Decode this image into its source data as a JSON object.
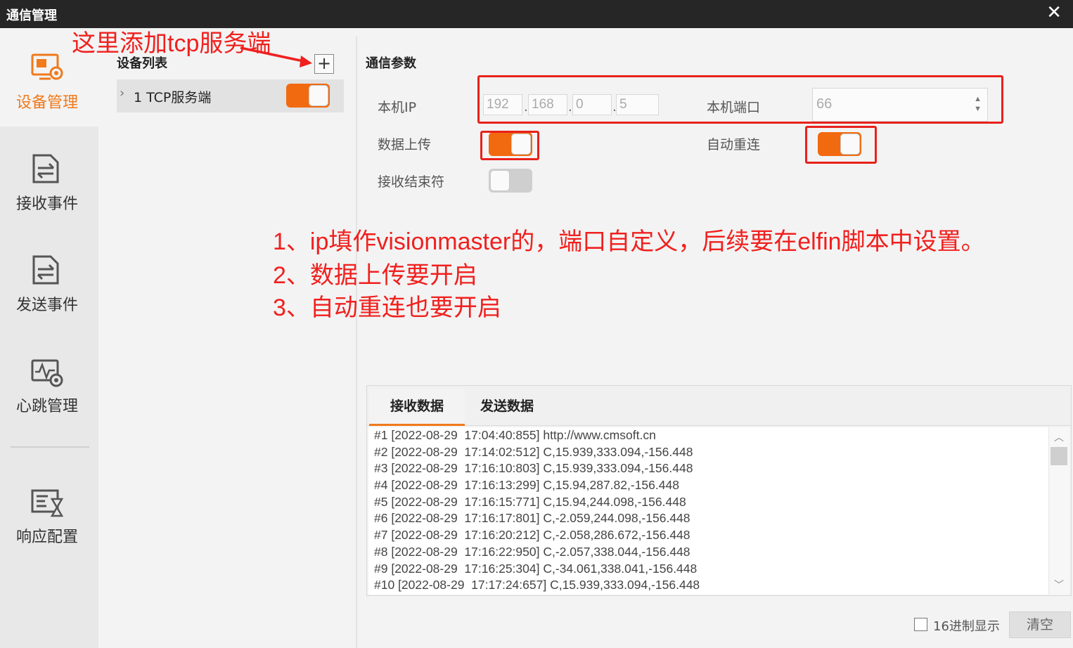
{
  "window": {
    "title": "通信管理",
    "close_glyph": "✕"
  },
  "sidebar": {
    "items": [
      {
        "label": "设备管理",
        "icon": "device-manage-icon",
        "active": true
      },
      {
        "label": "接收事件",
        "icon": "receive-event-icon",
        "active": false
      },
      {
        "label": "发送事件",
        "icon": "send-event-icon",
        "active": false
      },
      {
        "label": "心跳管理",
        "icon": "heartbeat-icon",
        "active": false
      },
      {
        "label": "响应配置",
        "icon": "response-config-icon",
        "active": false
      }
    ]
  },
  "device_list": {
    "header": "设备列表",
    "add_glyph": "+",
    "rows": [
      {
        "chevron": "›",
        "label": "1 TCP服务端",
        "enabled": true
      }
    ]
  },
  "params": {
    "header": "通信参数",
    "local_ip_label": "本机IP",
    "ip": [
      "192",
      "168",
      "0",
      "5"
    ],
    "local_port_label": "本机端口",
    "port": "66",
    "upload_label": "数据上传",
    "upload_on": true,
    "reconnect_label": "自动重连",
    "reconnect_on": true,
    "terminator_label": "接收结束符",
    "terminator_on": false
  },
  "annotations": {
    "add_hint": "这里添加tcp服务端",
    "line1": "1、ip填作visionmaster的，端口自定义，后续要在elfin脚本中设置。",
    "line2": "2、数据上传要开启",
    "line3": "3、自动重连也要开启",
    "color": "#f0201e"
  },
  "data_panel": {
    "tabs": [
      "接收数据",
      "发送数据"
    ],
    "active_tab": 0,
    "log": [
      "#1 [2022-08-29  17:04:40:855] http://www.cmsoft.cn",
      "#2 [2022-08-29  17:14:02:512] C,15.939,333.094,-156.448",
      "#3 [2022-08-29  17:16:10:803] C,15.939,333.094,-156.448",
      "#4 [2022-08-29  17:16:13:299] C,15.94,287.82,-156.448",
      "#5 [2022-08-29  17:16:15:771] C,15.94,244.098,-156.448",
      "#6 [2022-08-29  17:16:17:801] C,-2.059,244.098,-156.448",
      "#7 [2022-08-29  17:16:20:212] C,-2.058,286.672,-156.448",
      "#8 [2022-08-29  17:16:22:950] C,-2.057,338.044,-156.448",
      "#9 [2022-08-29  17:16:25:304] C,-34.061,338.041,-156.448",
      "#10 [2022-08-29  17:17:24:657] C,15.939,333.094,-156.448"
    ],
    "hex_label": "16进制显示",
    "clear_label": "清空"
  },
  "colors": {
    "accent": "#f07a1c",
    "toggle_on": "#f26a10",
    "highlight": "#e8211b"
  }
}
